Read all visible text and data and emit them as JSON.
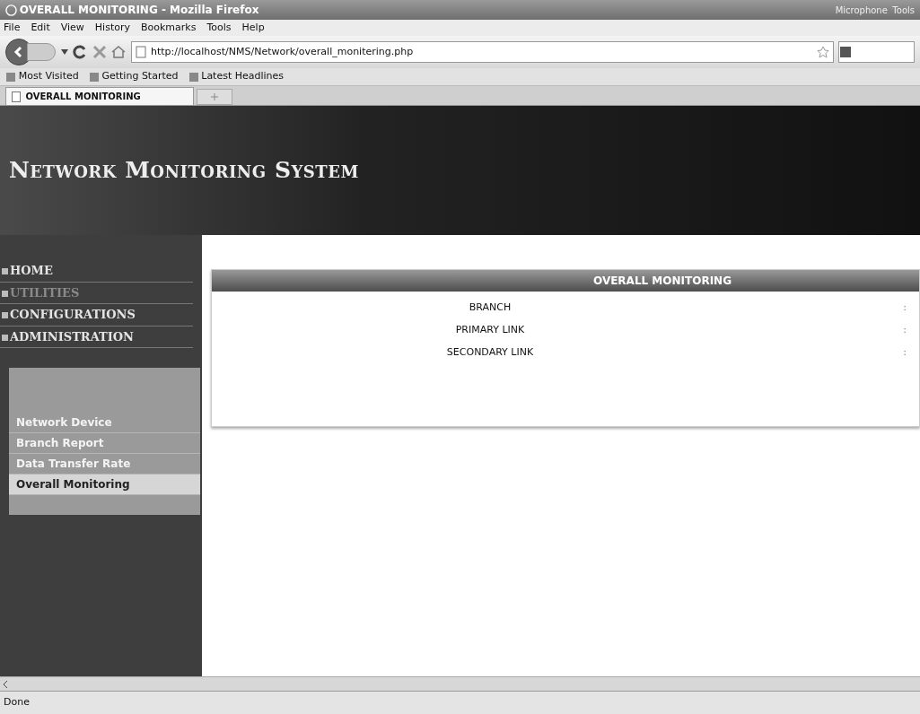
{
  "window": {
    "title": "OVERALL MONITORING - Mozilla Firefox",
    "tray": [
      "Microphone",
      "Tools"
    ]
  },
  "menu_bar": [
    "File",
    "Edit",
    "View",
    "History",
    "Bookmarks",
    "Tools",
    "Help"
  ],
  "address_bar": {
    "value": "http://localhost/NMS/Network/overall_monitering.php"
  },
  "bookmarks": [
    "Most Visited",
    "Getting Started",
    "Latest Headlines"
  ],
  "tabs": [
    {
      "label": "OVERALL MONITORING",
      "selected": true
    }
  ],
  "header": {
    "title": "Network Monitoring System"
  },
  "main_menu": [
    {
      "label": "HOME",
      "disabled": false
    },
    {
      "label": "UTILITIES",
      "disabled": true
    },
    {
      "label": "CONFIGURATIONS",
      "disabled": false
    },
    {
      "label": "ADMINISTRATION",
      "disabled": false
    }
  ],
  "sub_menu": [
    {
      "label": "Network Device",
      "selected": false
    },
    {
      "label": "Branch Report",
      "selected": false
    },
    {
      "label": "Data Transfer Rate",
      "selected": false
    },
    {
      "label": "Overall Monitoring",
      "selected": true
    }
  ],
  "panel": {
    "title": "OVERALL MONITORING",
    "rows": [
      {
        "label": "BRANCH",
        "separator": ":"
      },
      {
        "label": "PRIMARY LINK",
        "separator": ":"
      },
      {
        "label": "SECONDARY LINK",
        "separator": ":"
      }
    ]
  },
  "status_bar": "Done"
}
